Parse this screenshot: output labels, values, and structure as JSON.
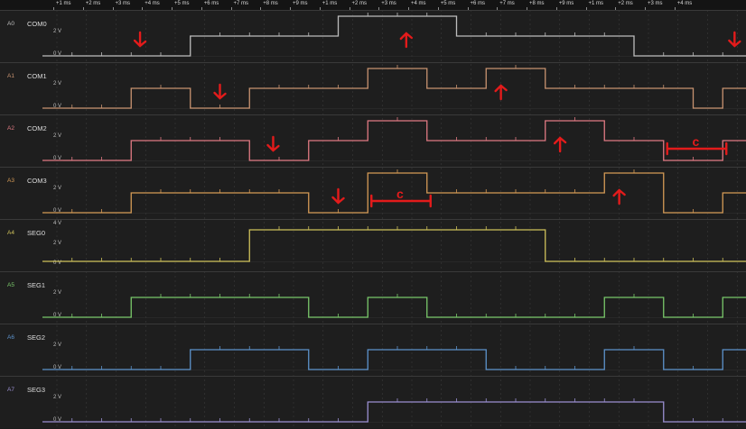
{
  "ruler": {
    "ticks": [
      "+1 ms",
      "+2 ms",
      "+3 ms",
      "+4 ms",
      "+5 ms",
      "+6 ms",
      "+7 ms",
      "+8 ms",
      "+9 ms",
      "+1 ms",
      "+2 ms",
      "+3 ms",
      "+4 ms",
      "+5 ms",
      "+6 ms",
      "+7 ms",
      "+8 ms",
      "+9 ms",
      "+1 ms",
      "+2 ms",
      "+3 ms",
      "+4 ms"
    ]
  },
  "channels": [
    {
      "id": "A0",
      "name": "COM0",
      "color": "#bdbdbd",
      "labels": [
        "2 V",
        "0 V"
      ],
      "levels": [
        0,
        0,
        0,
        0,
        0,
        1,
        1,
        1,
        1,
        1,
        2,
        2,
        2,
        2,
        1,
        1,
        1,
        1,
        1,
        1,
        0,
        0,
        0,
        0
      ],
      "annotations": [
        {
          "type": "arrow-down",
          "at": 3.3
        },
        {
          "type": "arrow-up",
          "at": 12.3
        },
        {
          "type": "arrow-down",
          "at": 23.4
        }
      ]
    },
    {
      "id": "A1",
      "name": "COM1",
      "color": "#c89370",
      "labels": [
        "2 V",
        "0 V"
      ],
      "levels": [
        0,
        0,
        0,
        1,
        1,
        0,
        0,
        1,
        1,
        1,
        1,
        2,
        2,
        1,
        1,
        2,
        2,
        1,
        1,
        1,
        1,
        1,
        0,
        1
      ],
      "annotations": [
        {
          "type": "arrow-down",
          "at": 6.0
        },
        {
          "type": "arrow-up",
          "at": 15.5
        }
      ]
    },
    {
      "id": "A2",
      "name": "COM2",
      "color": "#e07a83",
      "labels": [
        "2 V",
        "0 V"
      ],
      "levels": [
        0,
        0,
        0,
        1,
        1,
        1,
        1,
        0,
        0,
        1,
        1,
        2,
        2,
        1,
        1,
        1,
        1,
        2,
        2,
        1,
        1,
        0,
        0,
        1
      ],
      "annotations": [
        {
          "type": "arrow-down",
          "at": 7.8
        },
        {
          "type": "arrow-up",
          "at": 17.5
        },
        {
          "type": "bracket",
          "label": "c",
          "from": 21.0,
          "to": 23.0
        }
      ]
    },
    {
      "id": "A3",
      "name": "COM3",
      "color": "#d59a56",
      "labels": [
        "2 V",
        "0 V"
      ],
      "levels": [
        0,
        0,
        0,
        1,
        1,
        1,
        1,
        1,
        1,
        0,
        0,
        2,
        2,
        1,
        1,
        1,
        1,
        1,
        1,
        2,
        2,
        0,
        0,
        1
      ],
      "annotations": [
        {
          "type": "arrow-down",
          "at": 10.0
        },
        {
          "type": "arrow-up",
          "at": 19.5
        },
        {
          "type": "bracket",
          "label": "c",
          "from": 11.0,
          "to": 13.0
        }
      ]
    },
    {
      "id": "A4",
      "name": "SEG0",
      "color": "#cfc15a",
      "labels": [
        "4 V",
        "2 V",
        "0 V"
      ],
      "levels": [
        0,
        0,
        0,
        0,
        0,
        0,
        0,
        1,
        1,
        1,
        1,
        1,
        1,
        1,
        1,
        1,
        1,
        0,
        0,
        0,
        0,
        0,
        0,
        0
      ],
      "annotations": []
    },
    {
      "id": "A5",
      "name": "SEG1",
      "color": "#79c86a",
      "labels": [
        "2 V",
        "0 V"
      ],
      "levels": [
        0,
        0,
        0,
        1,
        1,
        1,
        1,
        1,
        1,
        0,
        0,
        1,
        1,
        0,
        0,
        0,
        0,
        0,
        0,
        1,
        1,
        0,
        0,
        1
      ],
      "annotations": []
    },
    {
      "id": "A6",
      "name": "SEG2",
      "color": "#5d93cc",
      "labels": [
        "2 V",
        "0 V"
      ],
      "levels": [
        0,
        0,
        0,
        0,
        0,
        1,
        1,
        1,
        1,
        0,
        0,
        1,
        1,
        1,
        1,
        0,
        0,
        0,
        0,
        1,
        1,
        0,
        0,
        1
      ],
      "annotations": []
    },
    {
      "id": "A7",
      "name": "SEG3",
      "color": "#9a8fd1",
      "labels": [
        "2 V",
        "0 V"
      ],
      "levels": [
        0,
        0,
        0,
        0,
        0,
        0,
        0,
        0,
        0,
        0,
        0,
        1,
        1,
        1,
        1,
        1,
        1,
        1,
        1,
        1,
        1,
        0,
        0,
        0
      ],
      "annotations": []
    }
  ]
}
